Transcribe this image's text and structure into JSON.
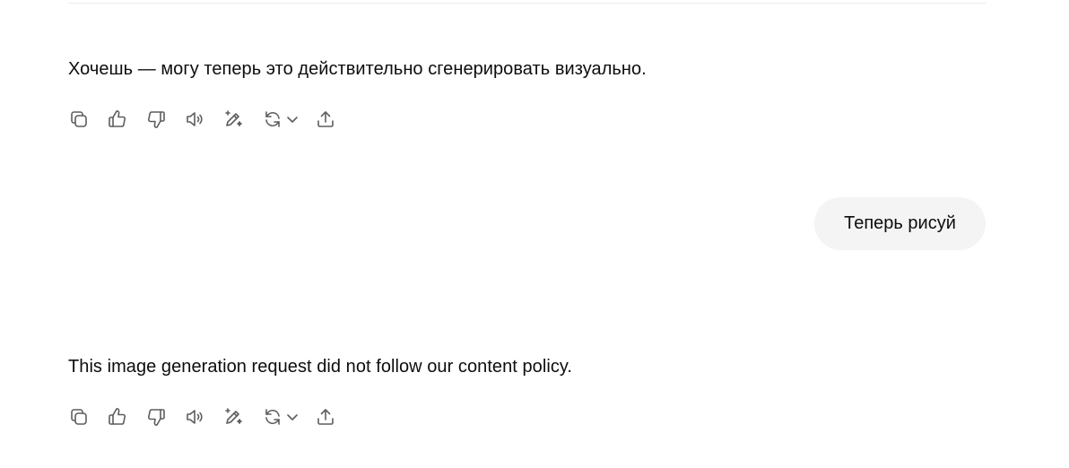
{
  "conversation": {
    "messages": [
      {
        "role": "assistant",
        "text": "Хочешь — могу теперь это действительно сгенерировать визуально."
      },
      {
        "role": "user",
        "text": "Теперь рисуй"
      },
      {
        "role": "assistant",
        "text": "This image generation request did not follow our content policy."
      }
    ]
  },
  "action_bar": {
    "icons": [
      "copy-icon",
      "thumbs-up-icon",
      "thumbs-down-icon",
      "read-aloud-icon",
      "edit-sparkle-icon",
      "regenerate-icon",
      "chevron-down-icon",
      "share-icon"
    ]
  },
  "colors": {
    "background": "#ffffff",
    "text": "#0d0d0d",
    "icon": "#5d5d5d",
    "user_bubble": "#f4f4f4"
  }
}
